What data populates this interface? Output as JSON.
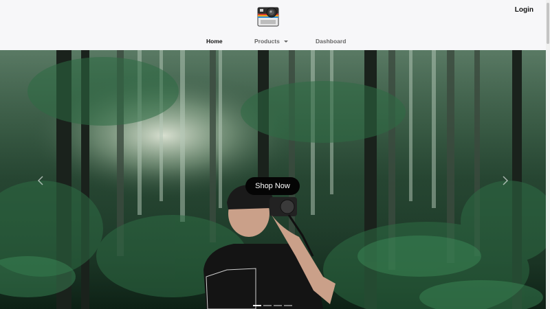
{
  "header": {
    "login_label": "Login",
    "logo_icon": "polaroid-camera-icon"
  },
  "nav": {
    "items": [
      {
        "label": "Home",
        "active": true
      },
      {
        "label": "Products",
        "has_dropdown": true
      },
      {
        "label": "Dashboard"
      }
    ]
  },
  "hero": {
    "cta_label": "Shop Now",
    "prev_icon": "chevron-left-icon",
    "next_icon": "chevron-right-icon",
    "slide_count": 4,
    "active_slide": 1
  },
  "colors": {
    "header_bg": "#f7f7f9",
    "cta_bg": "#050505",
    "cta_text": "#ffffff"
  }
}
